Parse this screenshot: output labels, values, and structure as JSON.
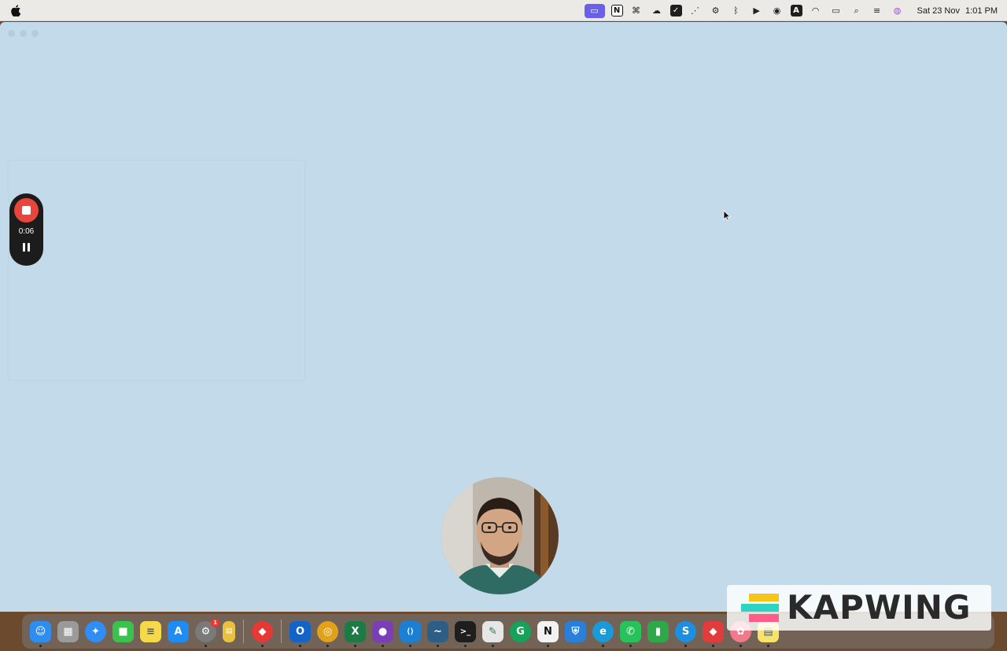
{
  "menubar": {
    "status_icons": [
      {
        "name": "screen-recorder-icon",
        "glyph": "▭",
        "active": true
      },
      {
        "name": "notion-menu-icon",
        "glyph": "N"
      },
      {
        "name": "grammar-menu-icon",
        "glyph": "⌘"
      },
      {
        "name": "cloud-sync-icon",
        "glyph": "☁"
      },
      {
        "name": "task-check-icon",
        "glyph": "✓"
      },
      {
        "name": "dots-icon",
        "glyph": "⋰"
      },
      {
        "name": "gear-icon",
        "glyph": "⚙"
      },
      {
        "name": "bluetooth-icon",
        "glyph": "ᛒ"
      },
      {
        "name": "play-circle-icon",
        "glyph": "▶"
      },
      {
        "name": "user-circle-icon",
        "glyph": "◉"
      },
      {
        "name": "input-source-icon",
        "glyph": "A"
      },
      {
        "name": "wifi-icon",
        "glyph": "◠"
      },
      {
        "name": "battery-icon",
        "glyph": "▭"
      },
      {
        "name": "spotlight-search-icon",
        "glyph": "⌕"
      },
      {
        "name": "control-center-icon",
        "glyph": "≡"
      },
      {
        "name": "siri-icon",
        "glyph": "◍"
      }
    ],
    "date": "Sat 23 Nov",
    "time": "1:01 PM"
  },
  "recorder": {
    "elapsed": "0:06"
  },
  "dock": {
    "apps": [
      {
        "name": "finder",
        "glyph": "☺",
        "color": "#2e8ef0"
      },
      {
        "name": "launchpad",
        "glyph": "▦",
        "color": "#9a9a9a"
      },
      {
        "name": "safari",
        "glyph": "✦",
        "color": "#2f8ef5"
      },
      {
        "name": "facetime",
        "glyph": "■",
        "color": "#3ac24f"
      },
      {
        "name": "notes",
        "glyph": "≡",
        "color": "#f5d94a"
      },
      {
        "name": "app-store",
        "glyph": "A",
        "color": "#1e8cf3"
      },
      {
        "name": "system-settings",
        "glyph": "⚙",
        "color": "#7a7a7a",
        "badge": "1"
      },
      {
        "name": "stickies",
        "glyph": "▤",
        "color": "#e8c140"
      },
      {
        "name": "anydesk",
        "glyph": "◆",
        "color": "#e53935"
      },
      {
        "name": "outlook",
        "glyph": "O",
        "color": "#1464c8"
      },
      {
        "name": "chrome",
        "glyph": "◎",
        "color": "#e0a11b"
      },
      {
        "name": "excel",
        "glyph": "X",
        "color": "#1d7a44"
      },
      {
        "name": "github-desktop",
        "glyph": "●",
        "color": "#7a3fb8"
      },
      {
        "name": "vscode",
        "glyph": "⟨⟩",
        "color": "#1b7fd4"
      },
      {
        "name": "mysql-workbench",
        "glyph": "~",
        "color": "#2d5f86"
      },
      {
        "name": "terminal",
        "glyph": ">_",
        "color": "#1e1e1e"
      },
      {
        "name": "textedit",
        "glyph": "✎",
        "color": "#e6e6e6"
      },
      {
        "name": "grammarly",
        "glyph": "G",
        "color": "#15a35a"
      },
      {
        "name": "notion",
        "glyph": "N",
        "color": "#f2f2f2"
      },
      {
        "name": "bitwarden",
        "glyph": "⛨",
        "color": "#2a80d8"
      },
      {
        "name": "edge",
        "glyph": "e",
        "color": "#1a9ad8"
      },
      {
        "name": "whatsapp",
        "glyph": "✆",
        "color": "#27c35a"
      },
      {
        "name": "numbers",
        "glyph": "▮",
        "color": "#2fa84a"
      },
      {
        "name": "skype",
        "glyph": "S",
        "color": "#1c8fe0"
      },
      {
        "name": "anydesk-2",
        "glyph": "◆",
        "color": "#e23b3b"
      },
      {
        "name": "photos",
        "glyph": "✿",
        "color": "#f07a8a"
      },
      {
        "name": "stickies-2",
        "glyph": "▤",
        "color": "#f7e36a"
      }
    ]
  },
  "watermark": {
    "text": "KAPWING"
  }
}
